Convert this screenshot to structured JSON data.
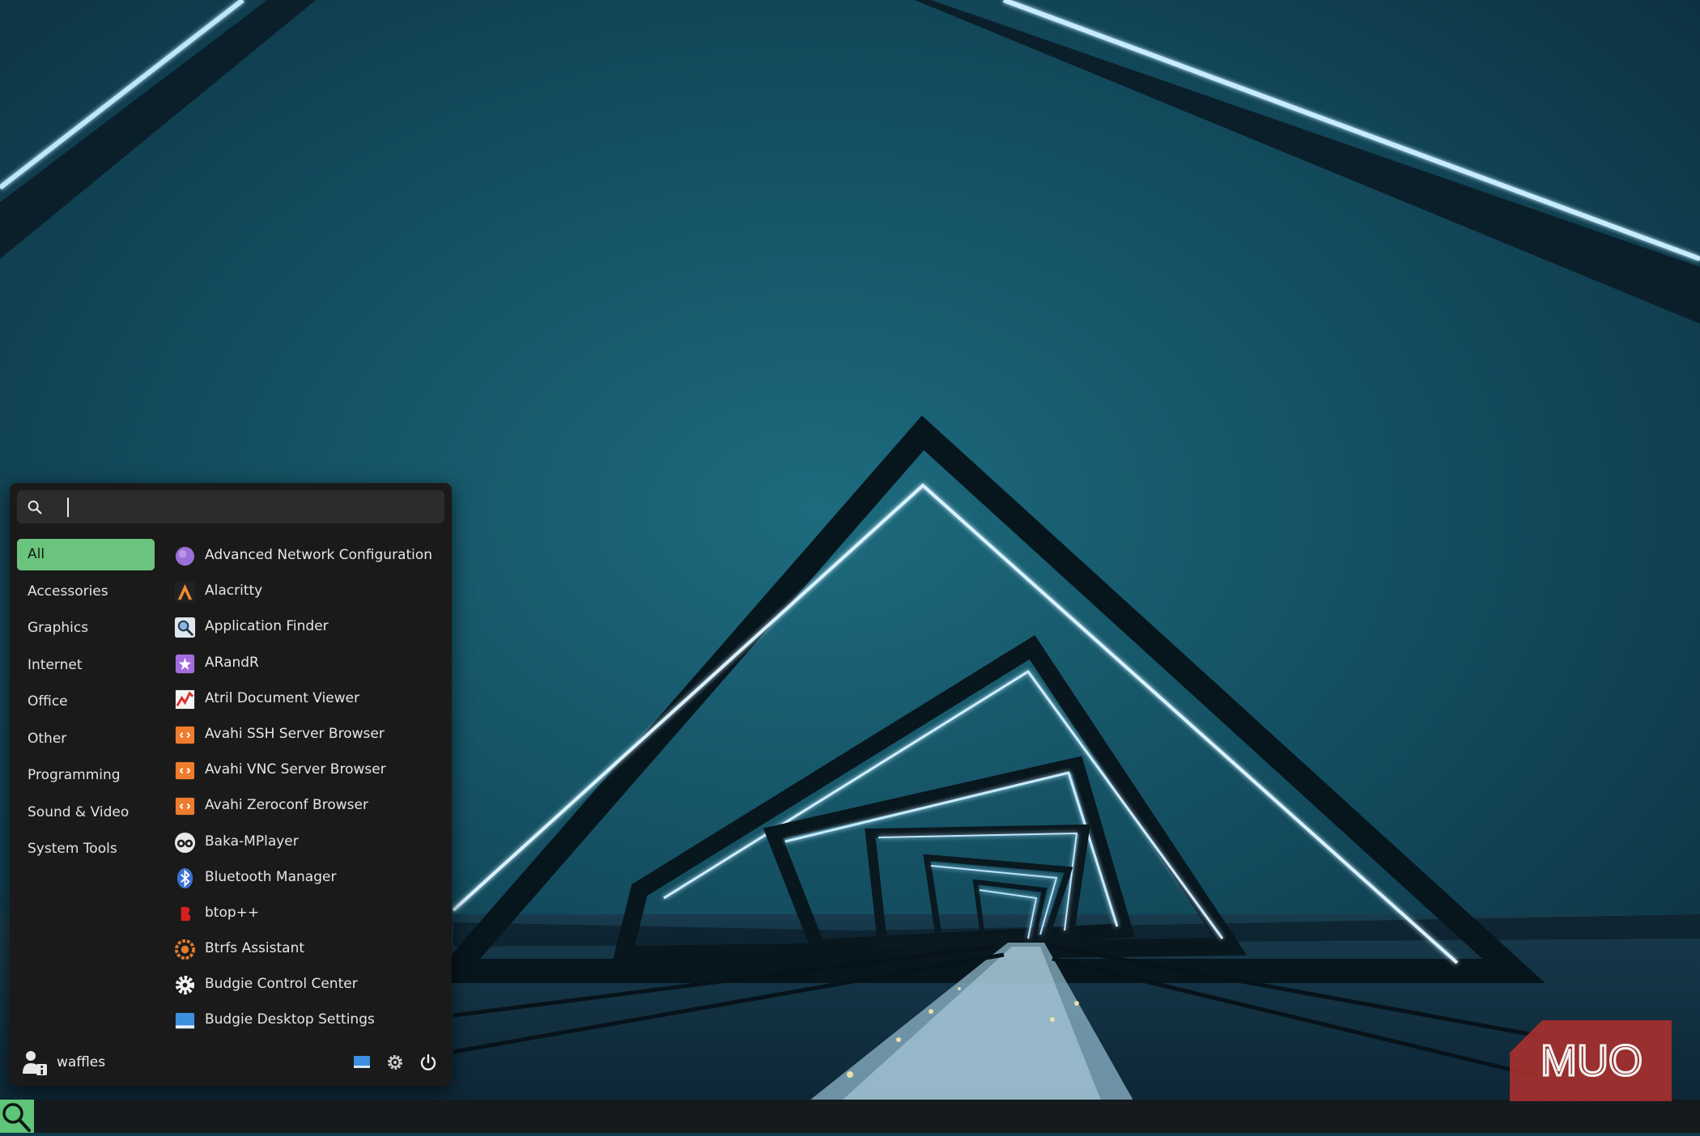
{
  "search": {
    "value": "",
    "placeholder": ""
  },
  "categories": [
    {
      "label": "All",
      "active": true
    },
    {
      "label": "Accessories"
    },
    {
      "label": "Graphics"
    },
    {
      "label": "Internet"
    },
    {
      "label": "Office"
    },
    {
      "label": "Other"
    },
    {
      "label": "Programming"
    },
    {
      "label": "Sound & Video"
    },
    {
      "label": "System Tools"
    }
  ],
  "apps": [
    {
      "label": "Advanced Network Configuration",
      "icon": "network-config-icon"
    },
    {
      "label": "Alacritty",
      "icon": "alacritty-icon"
    },
    {
      "label": "Application Finder",
      "icon": "app-finder-icon"
    },
    {
      "label": "ARandR",
      "icon": "arandr-icon"
    },
    {
      "label": "Atril Document Viewer",
      "icon": "atril-icon"
    },
    {
      "label": "Avahi SSH Server Browser",
      "icon": "avahi-ssh-icon"
    },
    {
      "label": "Avahi VNC Server Browser",
      "icon": "avahi-vnc-icon"
    },
    {
      "label": "Avahi Zeroconf Browser",
      "icon": "avahi-zeroconf-icon"
    },
    {
      "label": "Baka-MPlayer",
      "icon": "baka-mplayer-icon"
    },
    {
      "label": "Bluetooth Manager",
      "icon": "bluetooth-icon"
    },
    {
      "label": "btop++",
      "icon": "btop-icon"
    },
    {
      "label": "Btrfs Assistant",
      "icon": "btrfs-assistant-icon"
    },
    {
      "label": "Budgie Control Center",
      "icon": "gear-icon"
    },
    {
      "label": "Budgie Desktop Settings",
      "icon": "desktop-settings-icon"
    }
  ],
  "user": {
    "name": "waffles"
  },
  "footer_icons": [
    "display-icon",
    "settings-icon",
    "power-icon"
  ],
  "panel": {
    "launcher_icon": "search-icon"
  },
  "watermark": {
    "text": "MUO"
  },
  "colors": {
    "accent": "#6bc47d",
    "menu_bg": "#1a1a1a",
    "panel_bg": "#151a1c",
    "watermark_bg": "#a8302e"
  }
}
